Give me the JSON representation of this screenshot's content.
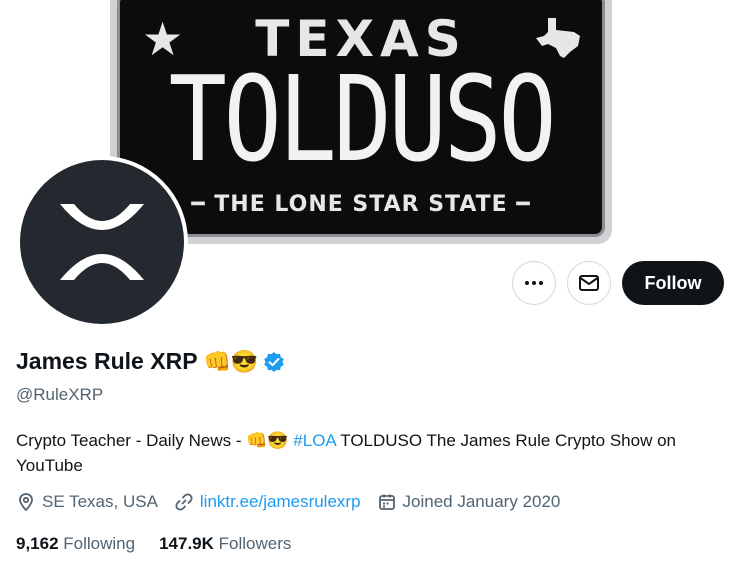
{
  "banner": {
    "plate_top_text": "TEXAS",
    "plate_main_text": "TOLDUSO",
    "plate_bottom_text": "THE LONE STAR STATE"
  },
  "actions": {
    "more_icon": "more-dots-icon",
    "message_icon": "envelope-icon",
    "follow_label": "Follow"
  },
  "profile": {
    "name": "James Rule XRP",
    "name_emojis": "👊😎",
    "handle": "@RuleXRP",
    "bio_part1": "Crypto Teacher - Daily News - ",
    "bio_emojis": "👊😎",
    "bio_hashtag": "#LOA",
    "bio_part2": " TOLDUSO The James Rule Crypto Show on YouTube",
    "location": "SE Texas, USA",
    "website": "linktr.ee/jamesrulexrp",
    "joined": "Joined January 2020"
  },
  "stats": {
    "following_count": "9,162",
    "following_label": "Following",
    "followers_count": "147.9K",
    "followers_label": "Followers"
  },
  "colors": {
    "accent": "#1d9bf0",
    "text_primary": "#0f1419",
    "text_secondary": "#536471",
    "follow_bg": "#0f1419"
  }
}
